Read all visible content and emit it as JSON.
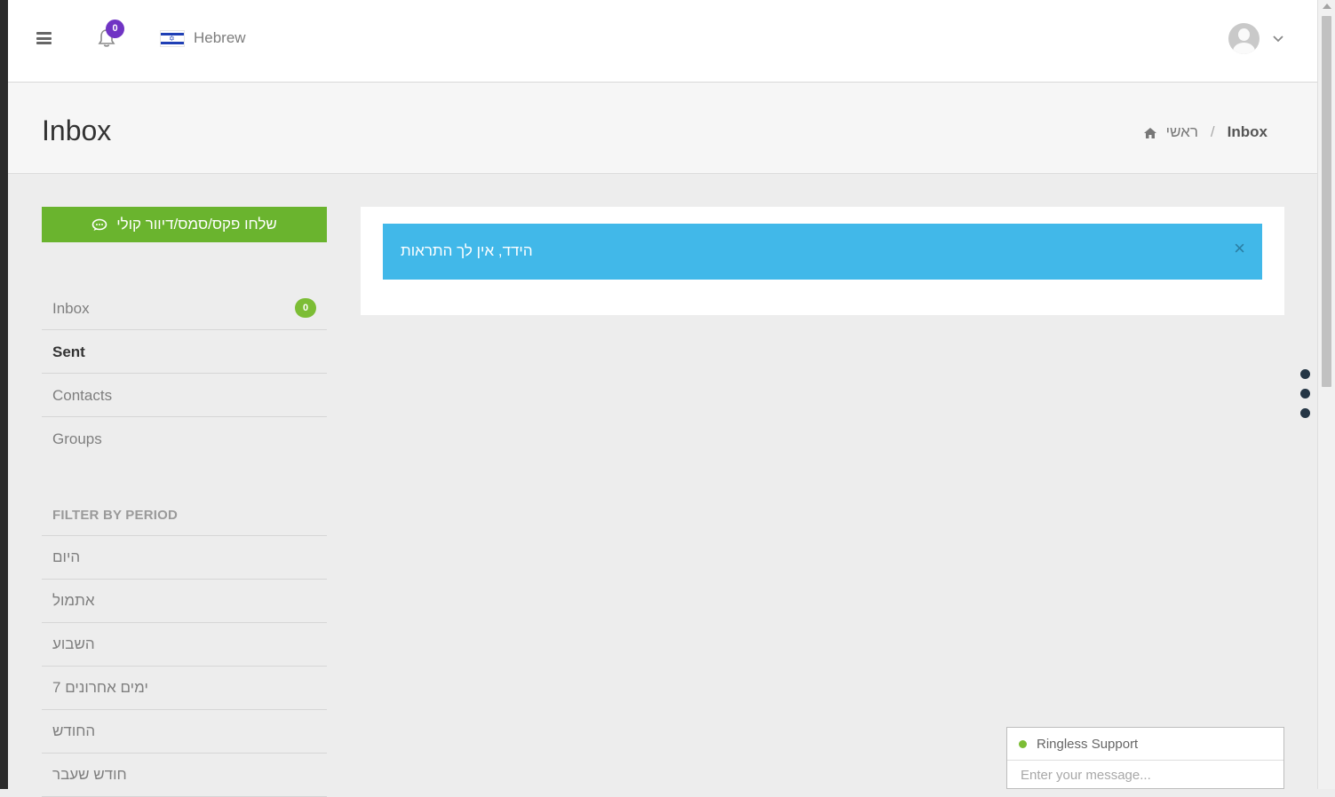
{
  "header": {
    "notifications_count": "0",
    "language_label": "Hebrew"
  },
  "page": {
    "title": "Inbox"
  },
  "breadcrumb": {
    "home_label": "ראשי",
    "separator": "/",
    "current": "Inbox"
  },
  "sidebar": {
    "send_button_label": "שלחו פקס/סמס/דיוור קולי",
    "items": [
      {
        "label": "Inbox",
        "badge": "0",
        "active": false
      },
      {
        "label": "Sent",
        "active": true
      },
      {
        "label": "Contacts",
        "active": false
      },
      {
        "label": "Groups",
        "active": false
      }
    ],
    "filter_heading": "FILTER BY PERIOD",
    "periods": [
      {
        "label": "היום"
      },
      {
        "label": "אתמול"
      },
      {
        "label": "השבוע"
      },
      {
        "label": "7 ימים אחרונים"
      },
      {
        "label": "החודש"
      },
      {
        "label": "חודש שעבר"
      }
    ]
  },
  "alert": {
    "message": "הידד, אין לך התראות",
    "close_symbol": "×"
  },
  "chat": {
    "title": "Ringless Support",
    "placeholder": "Enter your message..."
  },
  "colors": {
    "accent_green": "#6ab42e",
    "badge_purple": "#7034c4",
    "alert_blue": "#41b8e9",
    "dot_dark": "#253645"
  }
}
